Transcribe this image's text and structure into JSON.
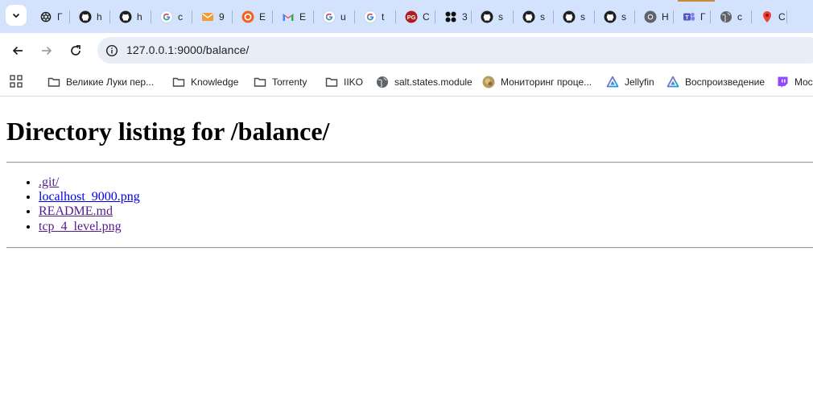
{
  "browser": {
    "tabs": [
      {
        "icon": "openai-icon",
        "title": "Г"
      },
      {
        "icon": "github-icon",
        "title": "h"
      },
      {
        "icon": "github-icon",
        "title": "h"
      },
      {
        "icon": "google-icon",
        "title": "c"
      },
      {
        "icon": "mail-icon",
        "title": "9"
      },
      {
        "icon": "orange-circle-icon",
        "title": "E"
      },
      {
        "icon": "gmail-icon",
        "title": "E"
      },
      {
        "icon": "google-icon",
        "title": "u"
      },
      {
        "icon": "google-icon",
        "title": "t"
      },
      {
        "icon": "pg-icon",
        "title": "C"
      },
      {
        "icon": "dots-icon",
        "title": "3"
      },
      {
        "icon": "github-icon",
        "title": "s"
      },
      {
        "icon": "github-icon",
        "title": "s"
      },
      {
        "icon": "github-icon",
        "title": "s"
      },
      {
        "icon": "github-icon",
        "title": "s"
      },
      {
        "icon": "chrome-icon",
        "title": "H"
      },
      {
        "icon": "teams-icon",
        "title": "Г"
      },
      {
        "icon": "globe-icon",
        "title": "c"
      },
      {
        "icon": "maps-pin-icon",
        "title": "C"
      }
    ],
    "address": {
      "url": "127.0.0.1:9000/balance/"
    },
    "bookmarks": [
      {
        "icon": "folder-icon",
        "label": "Великие Луки пер..."
      },
      {
        "icon": "folder-icon",
        "label": "Knowledge"
      },
      {
        "icon": "folder-icon",
        "label": "Torrenty"
      },
      {
        "icon": "folder-icon",
        "label": "IIKO"
      },
      {
        "icon": "globe-icon",
        "label": "salt.states.module"
      },
      {
        "icon": "avatar-icon",
        "label": "Мониторинг проце..."
      },
      {
        "icon": "jellyfin-icon",
        "label": "Jellyfin"
      },
      {
        "icon": "jellyfin-icon",
        "label": "Воспроизведение"
      },
      {
        "icon": "twitch-icon",
        "label": "Moc"
      }
    ]
  },
  "page": {
    "heading": "Directory listing for /balance/",
    "files": [
      {
        "name": ".git/",
        "visited": true
      },
      {
        "name": "localhost_9000.png",
        "visited": false
      },
      {
        "name": "README.md",
        "visited": true
      },
      {
        "name": "tcp_4_level.png",
        "visited": true
      }
    ]
  },
  "colors": {
    "tab_strip": "#d3e3fd",
    "omnibox": "#e9eef6",
    "link": "#0000ee",
    "visited_link": "#551a8b"
  }
}
